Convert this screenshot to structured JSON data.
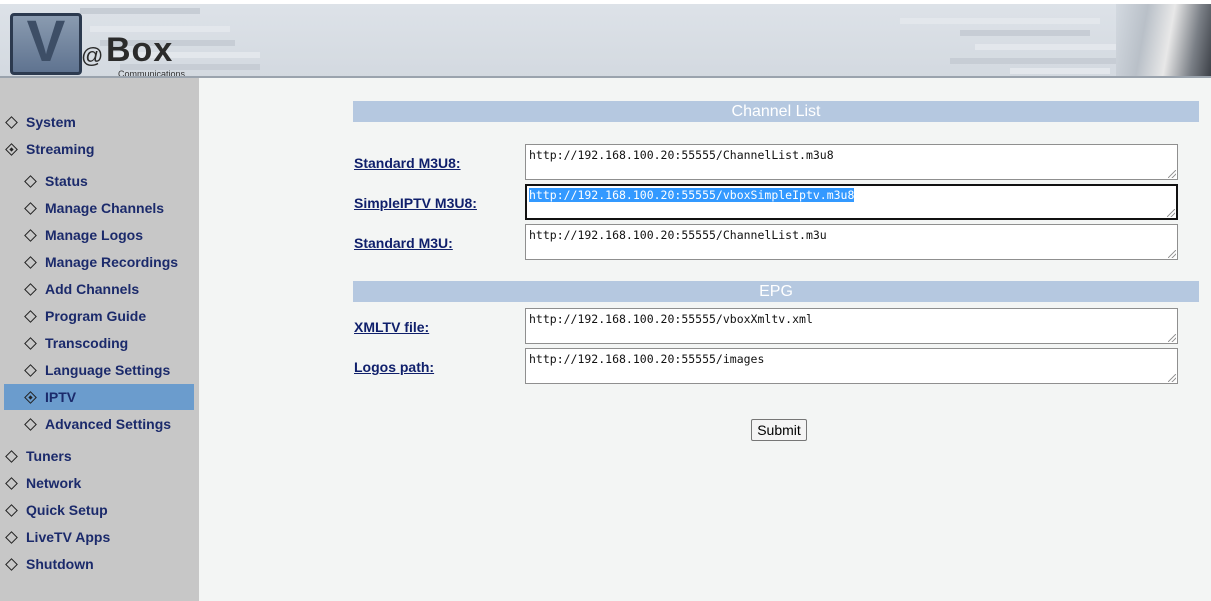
{
  "header": {
    "logo": {
      "v": "V",
      "at": "@",
      "box": "Box",
      "tagline": "Communications"
    }
  },
  "sidebar": {
    "items": [
      {
        "label": "System",
        "level": "top",
        "icon": "diamond-icon"
      },
      {
        "label": "Streaming",
        "level": "top",
        "icon": "diamond-filled-icon",
        "expanded": true
      },
      {
        "label": "Status",
        "level": "sub",
        "icon": "diamond-icon"
      },
      {
        "label": "Manage Channels",
        "level": "sub",
        "icon": "diamond-icon"
      },
      {
        "label": "Manage Logos",
        "level": "sub",
        "icon": "diamond-icon"
      },
      {
        "label": "Manage Recordings",
        "level": "sub",
        "icon": "diamond-icon"
      },
      {
        "label": "Add Channels",
        "level": "sub",
        "icon": "diamond-icon"
      },
      {
        "label": "Program Guide",
        "level": "sub",
        "icon": "diamond-icon"
      },
      {
        "label": "Transcoding",
        "level": "sub",
        "icon": "diamond-icon"
      },
      {
        "label": "Language Settings",
        "level": "sub",
        "icon": "diamond-icon"
      },
      {
        "label": "IPTV",
        "level": "sub",
        "icon": "diamond-filled-icon",
        "active": true
      },
      {
        "label": "Advanced Settings",
        "level": "sub",
        "icon": "diamond-icon"
      },
      {
        "label": "Tuners",
        "level": "top",
        "icon": "diamond-icon"
      },
      {
        "label": "Network",
        "level": "top",
        "icon": "diamond-icon"
      },
      {
        "label": "Quick Setup",
        "level": "top",
        "icon": "diamond-icon"
      },
      {
        "label": "LiveTV Apps",
        "level": "top",
        "icon": "diamond-icon"
      },
      {
        "label": "Shutdown",
        "level": "top",
        "icon": "diamond-icon"
      }
    ],
    "active_color": "#6b9ccd"
  },
  "channel_list": {
    "title": "Channel List",
    "fields": [
      {
        "label": "Standard M3U8:",
        "value": "http://192.168.100.20:55555/ChannelList.m3u8"
      },
      {
        "label": "SimpleIPTV M3U8:",
        "value": "http://192.168.100.20:55555/vboxSimpleIptv.m3u8",
        "selected": true
      },
      {
        "label": "Standard M3U:",
        "value": "http://192.168.100.20:55555/ChannelList.m3u"
      }
    ]
  },
  "epg": {
    "title": "EPG",
    "fields": [
      {
        "label": "XMLTV file:",
        "value": "http://192.168.100.20:55555/vboxXmltv.xml"
      },
      {
        "label": "Logos path:",
        "value": "http://192.168.100.20:55555/images"
      }
    ]
  },
  "form": {
    "submit_label": "Submit"
  },
  "colors": {
    "section_bar": "#b5c8e0",
    "sidebar_bg": "#c7c7c7",
    "link": "#0f1f6b",
    "selection": "#3399ff"
  }
}
